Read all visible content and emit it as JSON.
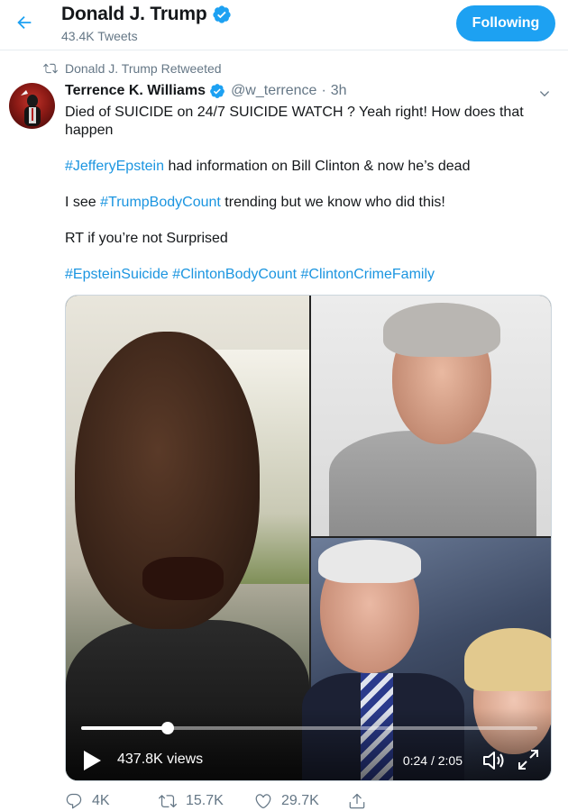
{
  "header": {
    "name": "Donald J. Trump",
    "tweet_count": "43.4K Tweets",
    "follow_label": "Following"
  },
  "retweet_context": "Donald J. Trump Retweeted",
  "tweet": {
    "author_name": "Terrence K. Williams",
    "handle": "@w_terrence",
    "separator": "·",
    "time": "3h",
    "line1": "Died of SUICIDE on 24/7 SUICIDE WATCH ? Yeah right! How does that happen",
    "line2_tag": "#JefferyEpstein",
    "line2_text": " had information on Bill Clinton & now he’s dead",
    "line3_pre": "I see ",
    "line3_tag": "#TrumpBodyCount",
    "line3_post": " trending but we know who did this!",
    "line4": "RT if you’re not Surprised",
    "tags": [
      "#EpsteinSuicide",
      "#ClintonBodyCount",
      "#ClintonCrimeFamily"
    ]
  },
  "video": {
    "views": "437.8K views",
    "time": "0:24 / 2:05",
    "progress": 0.19
  },
  "actions": {
    "replies": "4K",
    "retweets": "15.7K",
    "likes": "29.7K"
  },
  "colors": {
    "accent": "#1da1f2",
    "link": "#1b95e0",
    "muted": "#657786"
  },
  "icons": {
    "back": "arrow-left-icon",
    "verified": "verified-badge-icon",
    "retweet": "retweet-icon",
    "chevron": "chevron-down-icon",
    "play": "play-icon",
    "volume": "volume-icon",
    "fullscreen": "fullscreen-icon",
    "reply": "reply-icon",
    "like": "heart-icon",
    "share": "share-icon"
  }
}
